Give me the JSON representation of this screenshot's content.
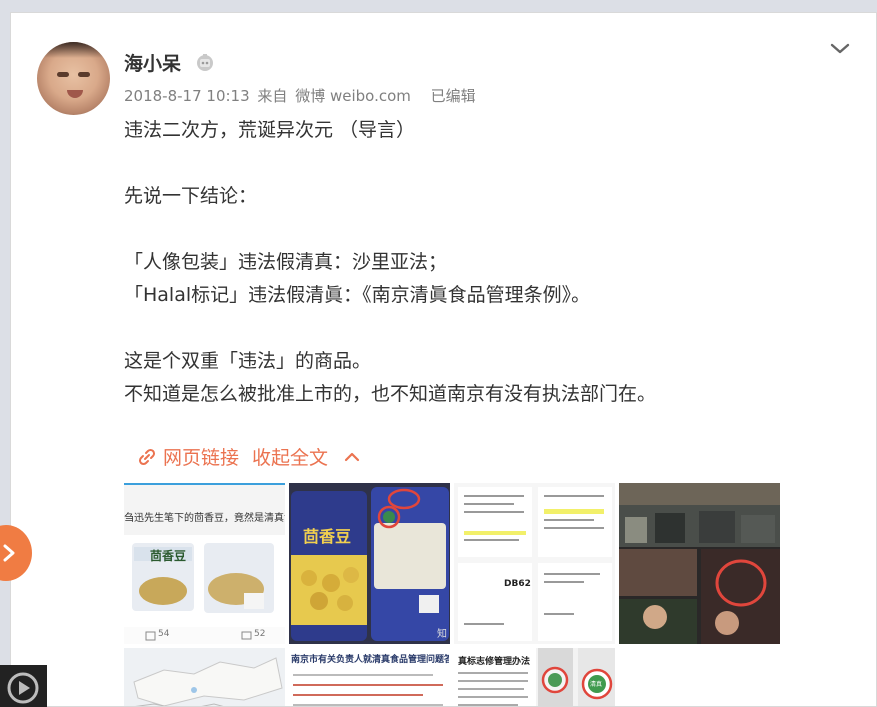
{
  "post": {
    "username": "海小呆",
    "meta": {
      "date": "2018-8-17 10:13",
      "from": "来自",
      "source": "微博 weibo.com",
      "edited": "已编辑"
    },
    "lines": [
      "违法二次方，荒诞异次元 （导言）",
      "",
      "先说一下结论：",
      "",
      "「人像包装」违法假清真：沙里亚法；",
      "「Halal标记」违法假清眞：《南京清眞食品管理条例》。",
      "",
      "这是个双重「违法」的商品。",
      "不知道是怎么被批准上市的，也不知道南京有没有执法部门在。"
    ],
    "actions": {
      "web_link": "网页链接",
      "collapse": "收起全文"
    }
  },
  "thumbnails": {
    "t1": {
      "caption": "刍迅先生笔下的茴香豆，竟然是清真食品。",
      "product": "茴香豆",
      "shares": "54",
      "comments": "52"
    },
    "t2": {
      "brand": "茴香豆",
      "watermark": "知"
    },
    "t3": {
      "code": "DB62"
    },
    "t6": {
      "headline": "南京市有关负责人就清真食品管理问题答记者问"
    },
    "t7": {
      "heading": "真标志修管理办法",
      "stamp": "清真"
    }
  },
  "colors": {
    "accent": "#eb7350",
    "meta_gray": "#808080",
    "text": "#333333",
    "side_button": "#f07c43"
  }
}
